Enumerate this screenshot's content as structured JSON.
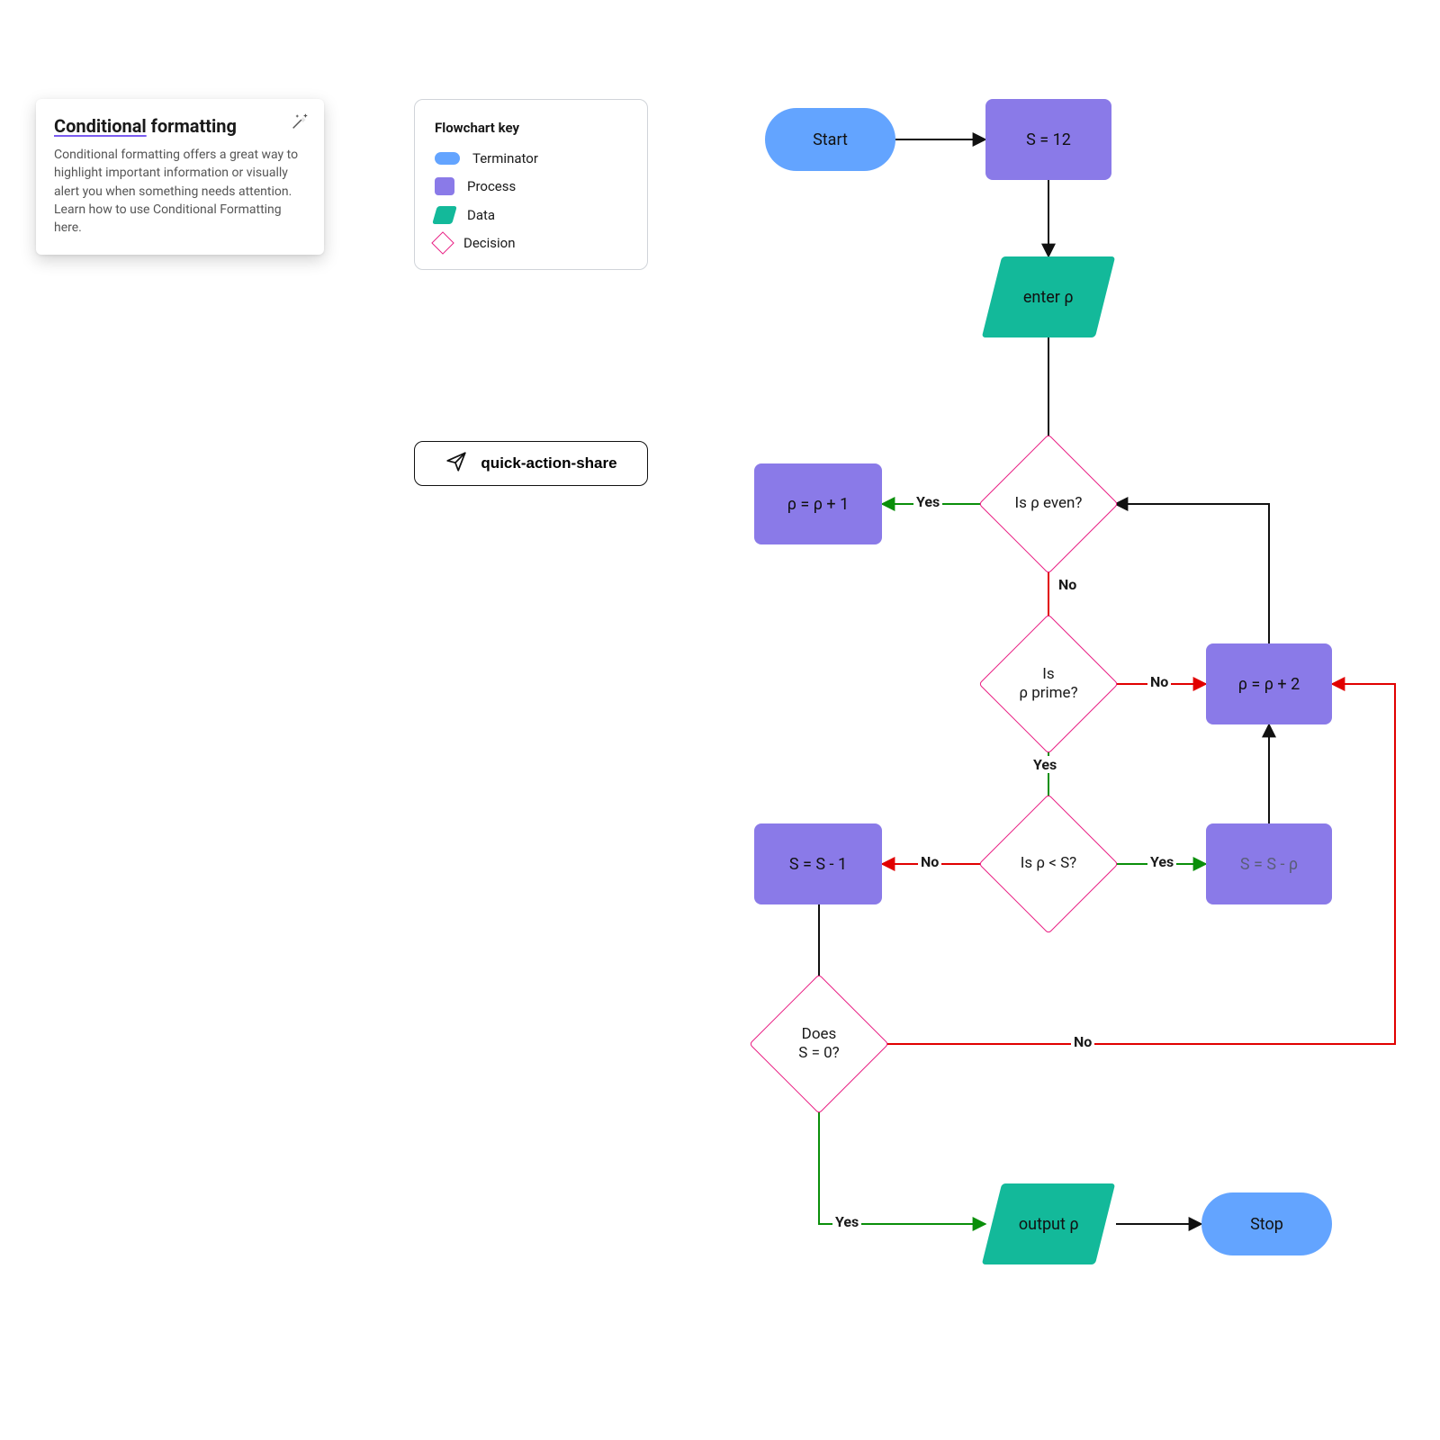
{
  "tip": {
    "title_first": "Conditional",
    "title_rest": " formatting",
    "body": "Conditional formatting offers a great way to highlight important information or visually alert you when something needs attention. Learn how to use Conditional Formatting here."
  },
  "legend": {
    "title": "Flowchart key",
    "items": {
      "terminator": "Terminator",
      "process": "Process",
      "data": "Data",
      "decision": "Decision"
    }
  },
  "quick_action": {
    "label": "quick-action-share"
  },
  "colors": {
    "terminator": "#63a4ff",
    "process": "#8a7ae8",
    "data": "#13b99a",
    "decision_border": "#e91e83",
    "edge_black": "#111111",
    "edge_green": "#0a8f0a",
    "edge_red": "#e10000"
  },
  "nodes": {
    "start": "Start",
    "init": "S = 12",
    "input": "enter ρ",
    "even": "Is ρ even?",
    "inc1": "ρ = ρ + 1",
    "prime": "Is\nρ prime?",
    "inc2": "ρ = ρ + 2",
    "lt": "Is ρ < S?",
    "sub_rho": "S = S - ρ",
    "sub_1": "S = S - 1",
    "zero": "Does\nS = 0?",
    "output": "output ρ",
    "stop": "Stop"
  },
  "labels": {
    "yes": "Yes",
    "no": "No"
  }
}
